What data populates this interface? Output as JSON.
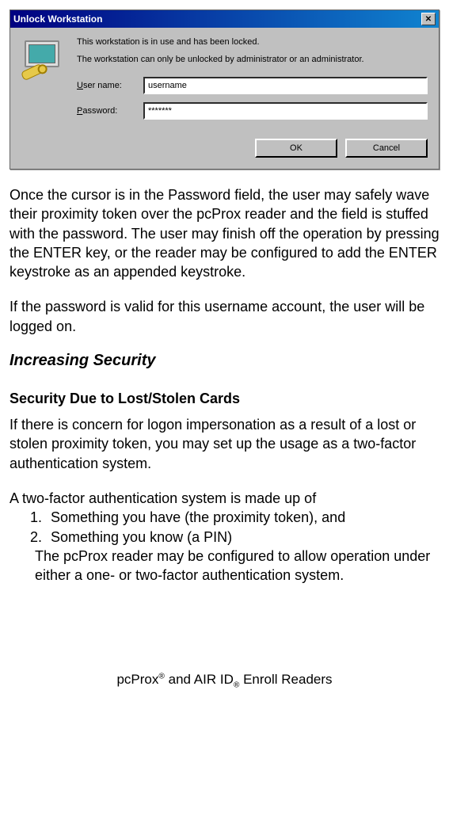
{
  "dialog": {
    "title": "Unlock Workstation",
    "close_label": "✕",
    "msg1": "This workstation is in use and has been locked.",
    "msg2": "The workstation can only be unlocked by administrator or an administrator.",
    "username_label_pre": "U",
    "username_label_post": "ser name:",
    "password_label_pre": "P",
    "password_label_post": "assword:",
    "username_value": "username",
    "password_value": "*******",
    "ok_label": "OK",
    "cancel_label": "Cancel"
  },
  "para1": "Once the cursor is in the Password field, the user may safely wave their proximity token over the pcProx reader and the field is stuffed with the password. The user may finish off the operation by pressing the ENTER key, or the reader may be configured to add the ENTER keystroke as an appended keystroke.",
  "para2": "If the password is valid for this username account, the user will be logged on.",
  "heading2": "Increasing Security",
  "heading3": "Security Due to Lost/Stolen Cards",
  "para3": "If there is concern for logon impersonation as a result of a lost or stolen proximity token, you may set up the usage as a two-factor authentication system.",
  "para4": "A two-factor authentication system is made up of",
  "list": [
    "Something you have (the proximity token), and",
    "Something you know (a PIN)"
  ],
  "para5": "The pcProx reader may be configured to allow operation under either a one- or two-factor authentication system.",
  "footer_pre": "pcProx",
  "footer_mid": " and AIR ID",
  "footer_post": " Enroll Readers"
}
